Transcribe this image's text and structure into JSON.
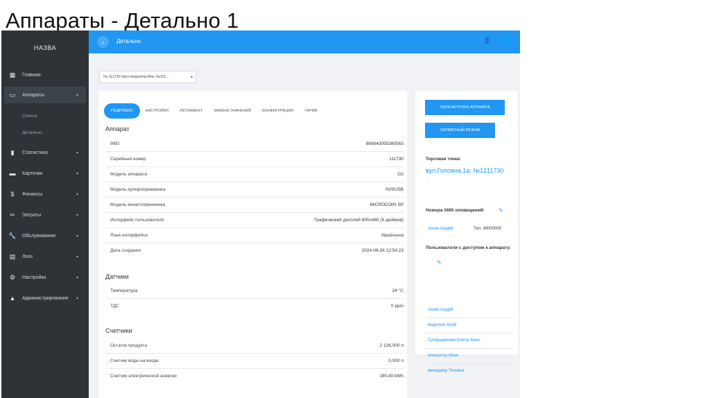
{
  "slide": {
    "title": "Аппараты - Детально 1"
  },
  "sidebar": {
    "brand": "НАЗВА",
    "items": [
      {
        "icon": "dashboard-icon",
        "glyph": "▦",
        "label": "Главная",
        "caret": ""
      },
      {
        "icon": "devices-icon",
        "glyph": "▭",
        "label": "Аппараты",
        "caret": "▾"
      },
      {
        "icon": "chart-icon",
        "glyph": "▮",
        "label": "Статистика",
        "caret": "▾"
      },
      {
        "icon": "card-icon",
        "glyph": "▬",
        "label": "Карточки",
        "caret": "▾"
      },
      {
        "icon": "finance-icon",
        "glyph": "$",
        "label": "Финансы",
        "caret": "▾"
      },
      {
        "icon": "expenses-icon",
        "glyph": "✂",
        "label": "Затраты",
        "caret": "▾"
      },
      {
        "icon": "wrench-icon",
        "glyph": "🔧",
        "label": "Обслуживание",
        "caret": "▾"
      },
      {
        "icon": "logs-icon",
        "glyph": "▤",
        "label": "Логи",
        "caret": "▾"
      },
      {
        "icon": "gear-icon",
        "glyph": "⚙",
        "label": "Настройки",
        "caret": "▾"
      },
      {
        "icon": "person-icon",
        "glyph": "▲",
        "label": "Администрирование",
        "caret": "▾"
      }
    ],
    "subitems": [
      "Список",
      "Детально"
    ]
  },
  "topbar": {
    "back": "‹",
    "title": "Детально",
    "user_glyph": "👤",
    "globe_glyph": "🌐"
  },
  "device_select": {
    "value": "№ 111730 (вул.Недоліна,49а; №111...",
    "arrow": "▾"
  },
  "tabs": [
    "ПОДРОБНО",
    "НАСТРОЙКИ",
    "РЕГЛАМЕНТ",
    "ЗАМЕНА ЗНАЧЕНИЙ",
    "КОНФИГУРАЦИЯ",
    "ТАРИФ"
  ],
  "apparatus": {
    "title": "Аппарат",
    "rows": [
      {
        "k": "IMEI",
        "v": "869943055380563"
      },
      {
        "k": "Серийный номер",
        "v": "111730"
      },
      {
        "k": "Модель аппарата",
        "v": "G2"
      },
      {
        "k": "Модель купюроприемника",
        "v": "NV9USB"
      },
      {
        "k": "Модель монетоприемника",
        "v": "MICROCOIN SP"
      },
      {
        "k": "Интерфейс пользователя",
        "v": "Графический дисплей 800x480 (5 дюймов)"
      },
      {
        "k": "Язык интерфейса",
        "v": "Українська"
      },
      {
        "k": "Дата создания",
        "v": "2024-08-26 12:54:23"
      }
    ]
  },
  "sensors": {
    "title": "Датчики",
    "rows": [
      {
        "k": "Температура",
        "v": "24 °C"
      },
      {
        "k": "ТДС",
        "v": "0 ppm"
      }
    ]
  },
  "counters": {
    "title": "Счетчики",
    "rows": [
      {
        "k": "Остаток продукта",
        "v": "2 126,000 л"
      },
      {
        "k": "Счетчик воды на входе",
        "v": "0,000 л"
      },
      {
        "k": "Счетчик электрической энергии",
        "v": "190,40 kWh"
      }
    ]
  },
  "side": {
    "reboot_label": "ПЕРЕЗАГРУЗКА АППАРАТА",
    "service_label": "СЕРВИСНЫЙ РЕЖИМ",
    "outlet_label": "Торговая точка:",
    "outlet_value": "вул.Головна,1а; №1211730",
    "outlet_dash": "–",
    "sms_label": "Номера SMS оповещений:",
    "sms_name": "технік Андрій",
    "sms_phone": "Тел. 38000000",
    "access_label": "Пользователи с доступом к аппарату:",
    "users": [
      "технік Андрій",
      "водитель Юрій",
      "Суперадминистратор Макс",
      "инкасатор Иван",
      "менеджер Тетьяна"
    ]
  },
  "colors": {
    "accent": "#2196f3",
    "sidebar": "#2f3338",
    "background": "#f1f2f5"
  }
}
